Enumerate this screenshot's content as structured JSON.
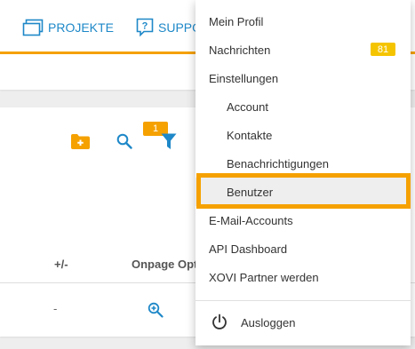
{
  "nav": {
    "projekte_label": "PROJEKTE",
    "support_label": "SUPPO",
    "icons": [
      "folders-icon",
      "help-chat-icon"
    ]
  },
  "toolbar": {
    "filter_count": "1",
    "icons": [
      "folder-add-icon",
      "search-icon",
      "filter-icon"
    ]
  },
  "table": {
    "columns": [
      "+/-",
      "Onpage Opt"
    ],
    "rows": [
      {
        "plusminus": "-",
        "onpage_icon": "zoom-in-icon"
      }
    ]
  },
  "menu": {
    "items": [
      {
        "label": "Mein Profil"
      },
      {
        "label": "Nachrichten",
        "badge": "81"
      },
      {
        "label": "Einstellungen"
      },
      {
        "label": "Account"
      },
      {
        "label": "Kontakte"
      },
      {
        "label": "Benachrichtigungen"
      },
      {
        "label": "Benutzer",
        "selected": true
      },
      {
        "label": "E-Mail-Accounts"
      },
      {
        "label": "API Dashboard"
      },
      {
        "label": "XOVI Partner werden"
      }
    ],
    "logout_label": "Ausloggen",
    "logout_icon": "power-icon"
  },
  "colors": {
    "accent": "#f5a100",
    "link_blue": "#1e88c8",
    "badge_yellow": "#f5c400"
  }
}
